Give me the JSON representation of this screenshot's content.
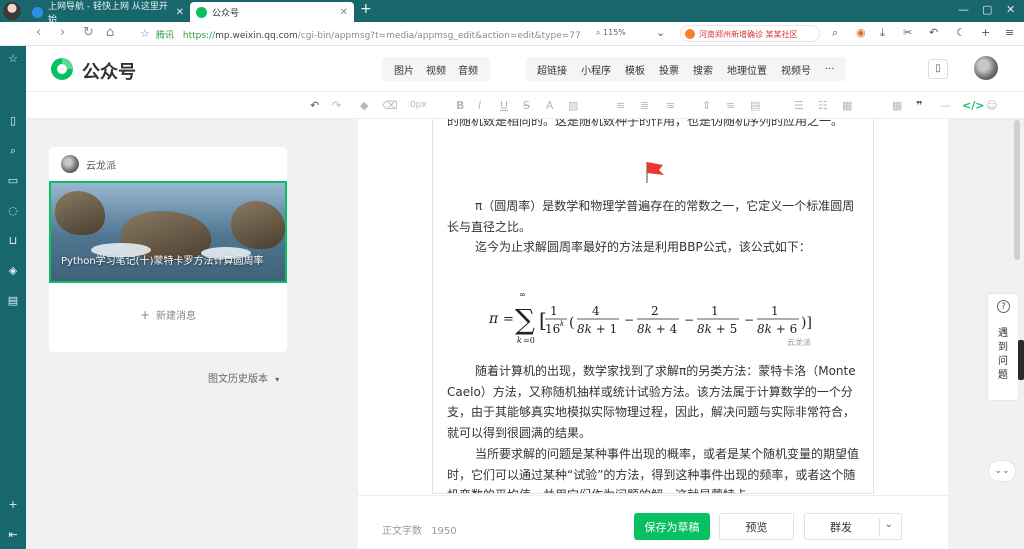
{
  "browser": {
    "tabs": [
      {
        "label": "上网导航 - 轻快上网 从这里开始",
        "active": false
      },
      {
        "label": "公众号",
        "active": true
      }
    ],
    "url": {
      "secure_label": "腾讯",
      "scheme": "https://",
      "host": "mp.weixin.qq.com",
      "path": "/cgi-bin/appmsg?t=media/appmsg_edit&action=edit&type=77"
    },
    "zoom": "115%",
    "search_text": "河南郑州新增确诊 某某社区",
    "window_controls": [
      "—",
      "▢",
      "✕"
    ]
  },
  "app": {
    "logo_text": "公众号",
    "media_group": [
      "图片",
      "视频",
      "音频"
    ],
    "function_group": [
      "超链接",
      "小程序",
      "模板",
      "投票",
      "搜索",
      "地理位置",
      "视频号",
      "···"
    ]
  },
  "toolbar": {
    "font_size": "0px"
  },
  "article_list": {
    "account_name": "云龙派",
    "cover_title": "Python学习笔记(十)蒙特卡罗方法计算圆周率",
    "new_message": "新建消息",
    "history_label": "图文历史版本"
  },
  "article": {
    "para_top": "的随机数是相同的。这是随机数种子的作用，也是伪随机序列的应用之一。",
    "para_pi": "π（圆周率）是数学和物理学普遍存在的常数之一，它定义一个标准圆周长与直径之比。",
    "para_bbp": "迄今为止求解圆周率最好的方法是利用BBP公式，该公式如下：",
    "formula_watermark": "云龙派",
    "para_mc": "随着计算机的出现，数学家找到了求解π的另类方法：蒙特卡洛（Monte Caelo）方法，又称随机抽样或统计试验方法。该方法属于计算数学的一个分支，由于其能够真实地模拟实际物理过程，因此，解决问题与实际非常符合，就可以得到很圆满的结果。",
    "para_last": "当所要求解的问题是某种事件出现的概率，或者是某个随机变量的期望值时，它们可以通过某种“试验”的方法，得到这种事件出现的频率，或者这个随机变数的平均值，并用它们作为问题的解。这就是蒙特卡"
  },
  "footer": {
    "word_count_label": "正文字数",
    "word_count": "1950",
    "save_label": "保存为草稿",
    "preview_label": "预览",
    "publish_label": "群发"
  },
  "feedback": {
    "label": "遇到问题"
  },
  "colors": {
    "brand_green": "#07c160",
    "sidebar_teal": "#17676c"
  },
  "icons": [
    "back-icon",
    "forward-icon",
    "refresh-icon",
    "home-icon",
    "star-icon",
    "download-icon",
    "scissors-icon",
    "undo-icon",
    "moon-icon",
    "plus-icon",
    "menu-icon",
    "flag-icon",
    "help-icon"
  ]
}
